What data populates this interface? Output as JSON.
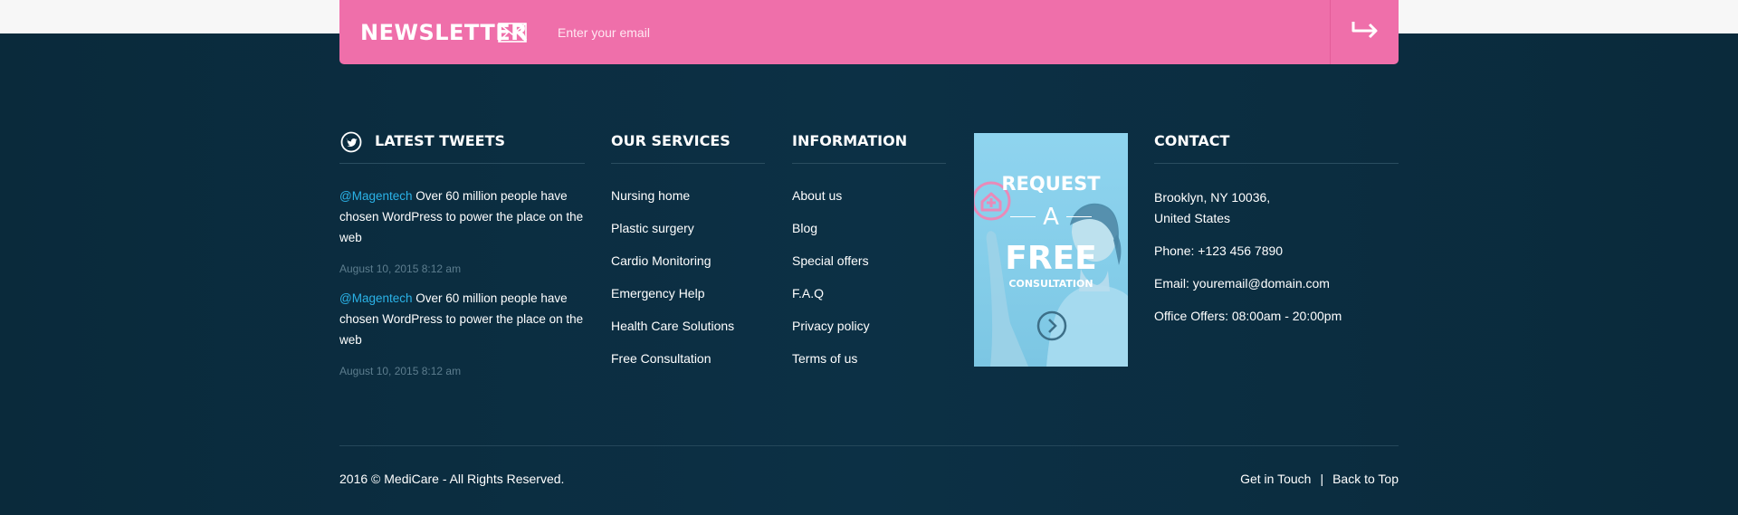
{
  "newsletter": {
    "title": "NEWSLETTER",
    "placeholder": "Enter your email",
    "icon": "envelope-icon",
    "submit_icon": "arrow-right-icon"
  },
  "tweets": {
    "title": "LATEST TWEETS",
    "icon": "twitter-icon",
    "items": [
      {
        "handle": "@Magentech",
        "text": " Over 60 million people have chosen WordPress to power the place on the web",
        "date": "August 10, 2015 8:12 am"
      },
      {
        "handle": "@Magentech",
        "text": " Over 60 million people have chosen WordPress to power the place on the web",
        "date": "August 10, 2015 8:12 am"
      }
    ]
  },
  "services": {
    "title": "OUR SERVICES",
    "items": [
      "Nursing home",
      "Plastic surgery",
      "Cardio Monitoring",
      "Emergency Help",
      "Health Care Solutions",
      "Free Consultation"
    ]
  },
  "information": {
    "title": "INFORMATION",
    "items": [
      "About us",
      "Blog",
      "Special offers",
      "F.A.Q",
      "Privacy policy",
      "Terms of us"
    ]
  },
  "promo": {
    "line1": "REQUEST",
    "line2": "A",
    "line3": "FREE",
    "line4": "CONSULTATION"
  },
  "contact": {
    "title": "CONTACT",
    "address_line1": "Brooklyn, NY 10036,",
    "address_line2": "United States",
    "phone": "Phone: +123 456 7890",
    "email": "Email: youremail@domain.com",
    "hours": "Office Offers: 08:00am - 20:00pm"
  },
  "bottom": {
    "copyright": "2016 © MediCare - All Rights Reserved.",
    "get_in_touch": "Get in Touch",
    "separator": "|",
    "back_to_top": "Back to Top"
  },
  "colors": {
    "newsletter_bg": "#ef6faa",
    "footer_bg": "#0d2f42",
    "link_accent": "#2bb3e8",
    "promo_bg": "#8fd4ef"
  }
}
